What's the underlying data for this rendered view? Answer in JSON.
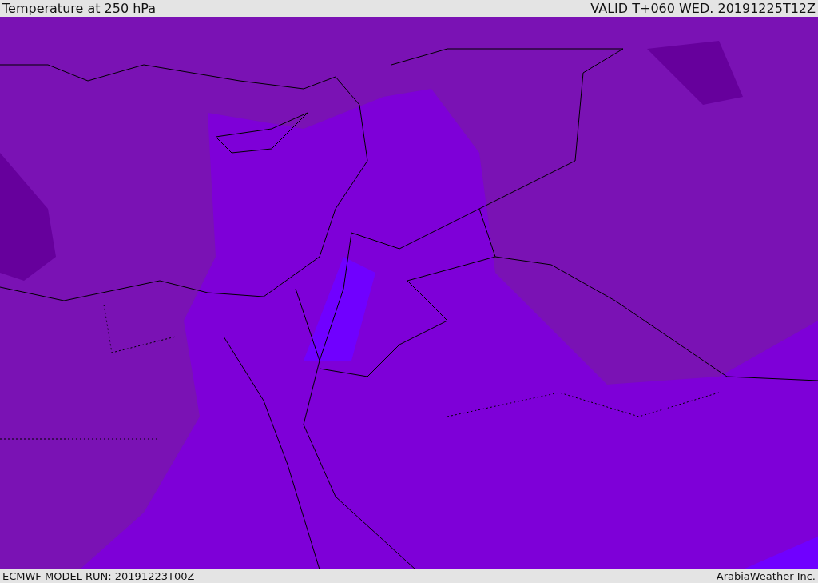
{
  "header": {
    "title": "Temperature at 250 hPa",
    "valid": "VALID T+060 WED. 20191225T12Z"
  },
  "footer": {
    "model_run": "ECMWF MODEL RUN: 20191223T00Z",
    "credit": "ArabiaWeather Inc."
  }
}
